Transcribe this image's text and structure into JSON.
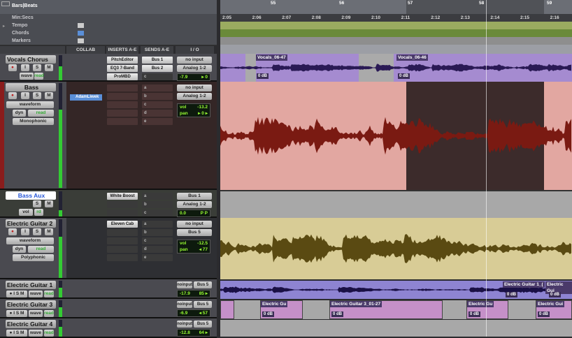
{
  "rulers": {
    "bars_beats": "Bars|Beats",
    "min_secs": "Min:Secs",
    "tempo": "Tempo",
    "chords": "Chords",
    "markers": "Markers"
  },
  "bar_numbers": [
    "55",
    "56",
    "57",
    "58",
    "59"
  ],
  "time_labels": [
    "2:05",
    "2:06",
    "2:07",
    "2:08",
    "2:09",
    "2:10",
    "2:11",
    "2:12",
    "2:13",
    "2:14",
    "2:15",
    "2:16"
  ],
  "columns": {
    "collab": "COLLAB",
    "inserts": "INSERTS A-E",
    "sends": "SENDS A-E",
    "io": "I / O"
  },
  "colors": {
    "vocals": "#a58bd0",
    "bass": "#e2a7a1",
    "bass_selected": "#3c2b2b",
    "bass_aux": "#a8a8a8",
    "guitar2": "#d8cc96",
    "guitar1": "#8e84d2",
    "guitar3": "#c590c8"
  },
  "tracks": {
    "vocals": {
      "name": "Vocals Chorus",
      "view": "wave",
      "mode": "read",
      "inserts": [
        "PitchEditor",
        "EQ3 7-Band",
        "ProMBD"
      ],
      "sends": [
        "Bus 1",
        "Bus 2",
        ""
      ],
      "send_letters": [
        "a",
        "b",
        "c"
      ],
      "input": "no input",
      "output": "Analog 1-2",
      "vol": "-7.9",
      "pan": "▸ 0",
      "clips": [
        {
          "name": "Vocals_06-47",
          "gain": "0 dB"
        },
        {
          "name": "Vocals_06-46",
          "gain": "0 dB"
        }
      ]
    },
    "bass": {
      "name": "Bass",
      "view": "waveform",
      "auto": "dyn",
      "mode": "read",
      "voice": "Monophonic",
      "collab_user": "AdamLiwek",
      "send_letters": [
        "a",
        "b",
        "c",
        "d",
        "e"
      ],
      "input": "no input",
      "output": "Analog 1-2",
      "vol_label": "vol",
      "vol": "-13.2",
      "pan_label": "pan",
      "pan": "▸ 0 ▸"
    },
    "bass_aux": {
      "name": "Bass Aux",
      "auto": "vol",
      "mode": "rd",
      "inserts": [
        "White Boost"
      ],
      "send_letters": [
        "a",
        "b",
        "c"
      ],
      "input": "Bus 1",
      "output": "Analog 1-2",
      "vol": "0.0",
      "pan": "P  P"
    },
    "guitar2": {
      "name": "Electric Guitar 2",
      "view": "waveform",
      "auto": "dyn",
      "mode": "read",
      "voice": "Polyphonic",
      "inserts": [
        "Eleven Cab"
      ],
      "send_letters": [
        "a",
        "b",
        "c",
        "d",
        "e"
      ],
      "input": "no input",
      "output": "Bus 5",
      "vol_label": "vol",
      "vol": "-12.5",
      "pan_label": "pan",
      "pan": "◂ 77"
    },
    "guitar1": {
      "name": "Electric Guitar 1",
      "view": "wave",
      "mode": "read",
      "input": "noinput",
      "output": "Bus 5",
      "vol": "-17.9",
      "pan": "85 ▸",
      "clips": [
        {
          "name": "Electric Guitar 1_(",
          "gain": "0 dB"
        },
        {
          "name": "Electric Gui",
          "gain": "0 dB"
        }
      ]
    },
    "guitar3": {
      "name": "Electric Guitar 3",
      "view": "wave",
      "mode": "read",
      "input": "noinput",
      "output": "Bus 5",
      "vol": "-6.9",
      "pan": "◂ 57",
      "clips": [
        {
          "name": "Electric Gu",
          "gain": "0 dB"
        },
        {
          "name": "Electric Guitar 3_01-27",
          "gain": "0 dB"
        },
        {
          "name": "Electric Gu",
          "gain": "0 dB"
        },
        {
          "name": "Electric Gui",
          "gain": "0 dB"
        }
      ]
    },
    "guitar4": {
      "name": "Electric Guitar 4",
      "view": "wave",
      "mode": "read",
      "input": "noinput",
      "output": "Bus 5",
      "vol": "-12.8",
      "pan": "64 ▸"
    }
  },
  "buttons": {
    "rec": "●",
    "input": "I",
    "solo": "S",
    "mute": "M"
  }
}
